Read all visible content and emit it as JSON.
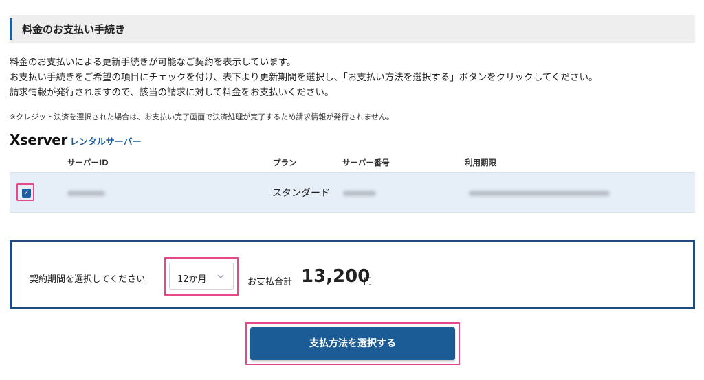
{
  "section": {
    "title": "料金のお支払い手続き"
  },
  "description": {
    "line1": "料金のお支払いによる更新手続きが可能なご契約を表示しています。",
    "line2": "お支払い手続きをご希望の項目にチェックを付け、表下より更新期間を選択し、「お支払い方法を選択する」ボタンをクリックしてください。",
    "line3": "請求情報が発行されますので、該当の請求に対して料金をお支払いください。"
  },
  "note": "※クレジット決済を選択された場合は、お支払い完了画面で決済処理が完了するため請求情報が発行されません。",
  "brand": {
    "logo": "Xserver",
    "sub": "レンタルサーバー"
  },
  "table": {
    "headers": [
      "サーバーID",
      "プラン",
      "サーバー番号",
      "利用期限"
    ],
    "rows": [
      {
        "checked": true,
        "plan": "スタンダード"
      }
    ]
  },
  "period": {
    "label": "契約期間を選択してください",
    "selected": "12か月",
    "total_label": "お支払合計",
    "total_amount": "13,200",
    "currency": "円"
  },
  "submit_label": "支払方法を選択する",
  "colors": {
    "accent": "#1e5e9e",
    "button": "#1b5b96",
    "highlight": "#e8478c",
    "row_bg": "#e6eef8"
  }
}
